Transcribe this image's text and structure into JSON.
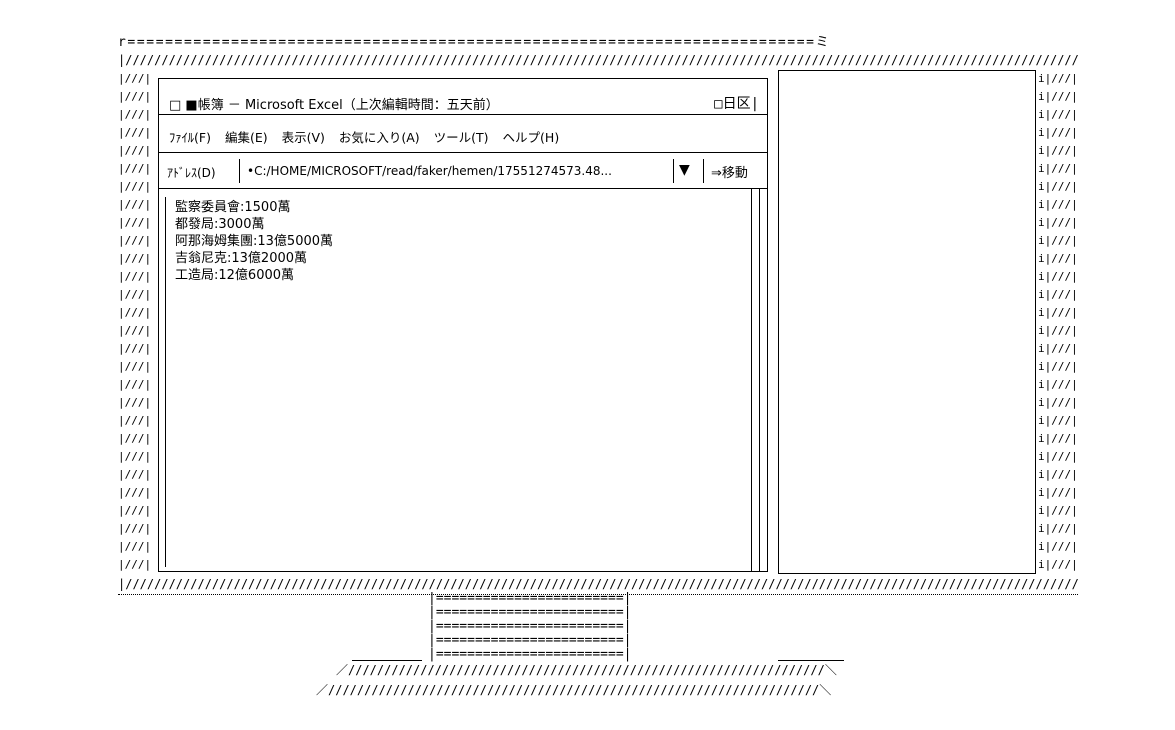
{
  "window": {
    "title": "□ ■帳簿 － Microsoft Excel（上次編輯時間：五天前）",
    "controls": "□日区|"
  },
  "menu": {
    "items": [
      "ﾌｧｲﾙ(F)",
      "編集(E)",
      "表示(V)",
      "お気に入り(A)",
      "ツール(T)",
      "ヘルプ(H)"
    ]
  },
  "address_bar": {
    "label": "ｱﾄﾞﾚｽ(D)",
    "value": "•C:/HOME/MICROSOFT/read/faker/hemen/17551274573.48...",
    "dropdown_icon": "▼",
    "go_label": "⇒移動"
  },
  "content": {
    "lines": [
      "監察委員會:1500萬",
      "都發局:3000萬",
      "阿那海姆集團:13億5000萬",
      "吉翁尼克:13億2000萬",
      "工造局:12億6000萬"
    ]
  }
}
